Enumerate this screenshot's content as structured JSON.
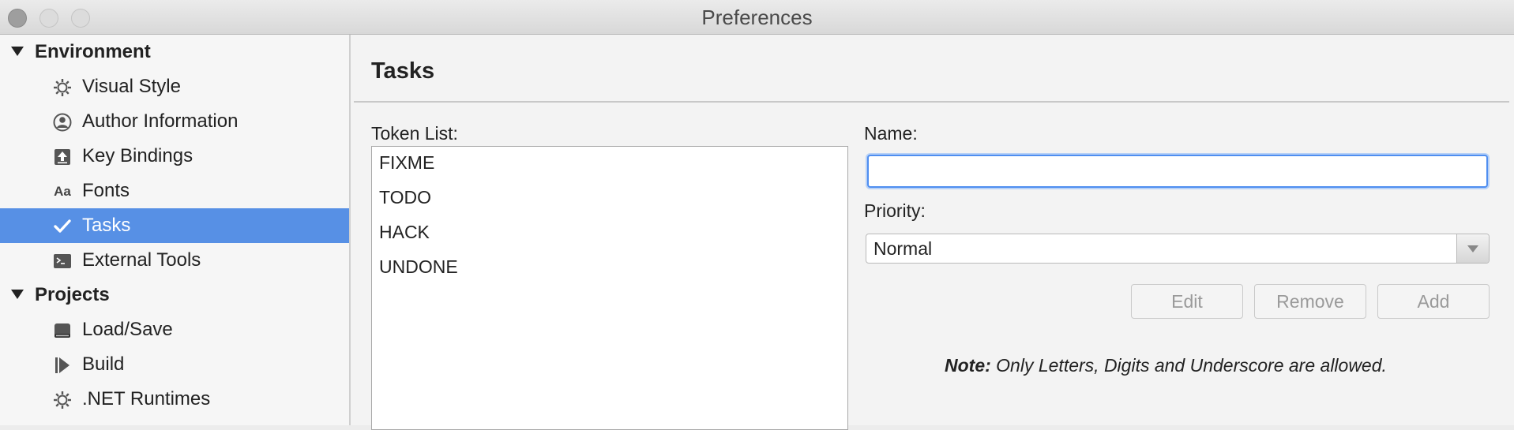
{
  "window": {
    "title": "Preferences"
  },
  "sidebar": {
    "sections": [
      {
        "label": "Environment",
        "items": [
          {
            "label": "Visual Style",
            "icon": "gear-icon"
          },
          {
            "label": "Author Information",
            "icon": "user-icon"
          },
          {
            "label": "Key Bindings",
            "icon": "keyboard-upload-icon"
          },
          {
            "label": "Fonts",
            "icon": "font-icon"
          },
          {
            "label": "Tasks",
            "icon": "checkmark-icon",
            "selected": true
          },
          {
            "label": "External Tools",
            "icon": "terminal-icon"
          }
        ]
      },
      {
        "label": "Projects",
        "items": [
          {
            "label": "Load/Save",
            "icon": "drive-icon"
          },
          {
            "label": "Build",
            "icon": "build-play-icon"
          },
          {
            "label": ".NET Runtimes",
            "icon": "gear-icon"
          }
        ]
      }
    ]
  },
  "main": {
    "heading": "Tasks",
    "token_list_label": "Token List:",
    "tokens": [
      "FIXME",
      "TODO",
      "HACK",
      "UNDONE"
    ],
    "name_label": "Name:",
    "name_value": "",
    "priority_label": "Priority:",
    "priority_value": "Normal",
    "buttons": {
      "edit": "Edit",
      "remove": "Remove",
      "add": "Add"
    },
    "note_bold": "Note:",
    "note_text": " Only Letters, Digits and Underscore are allowed."
  },
  "colors": {
    "selection": "#5790e5",
    "focus_ring": "#4f8ef0"
  }
}
